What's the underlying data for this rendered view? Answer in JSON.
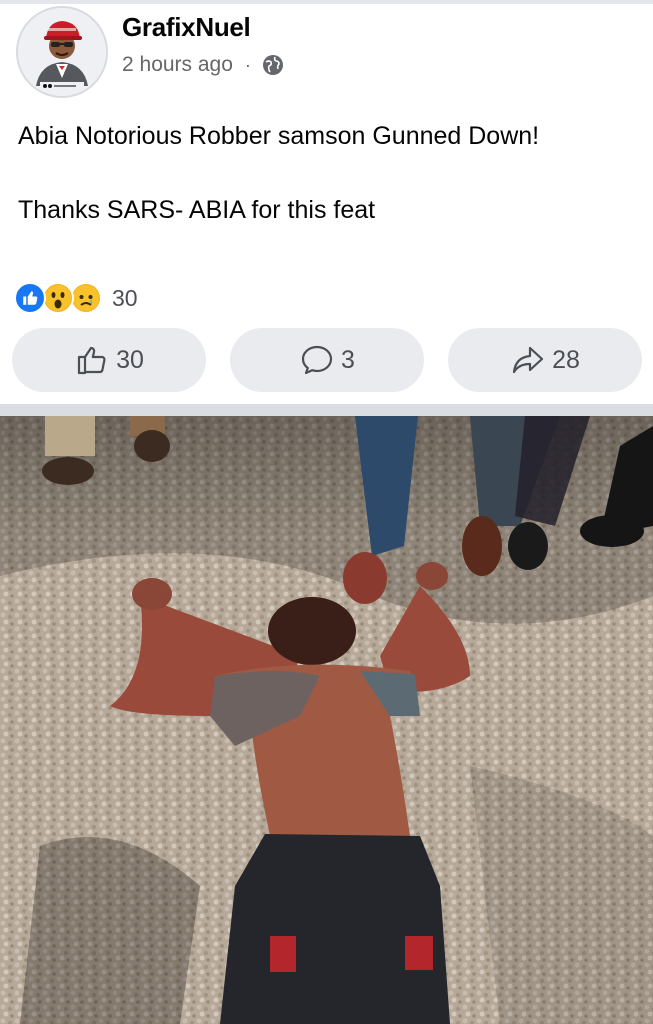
{
  "post": {
    "author": "GrafixNuel",
    "time": "2 hours ago",
    "separator": "·",
    "audience_icon": "globe-icon",
    "text_line1": "Abia Notorious Robber samson Gunned Down!",
    "text_line2": "Thanks SARS- ABIA for this feat",
    "reactions": {
      "types": [
        "like",
        "wow",
        "sad"
      ],
      "count": "30"
    },
    "actions": {
      "like_count": "30",
      "comment_count": "3",
      "share_count": "28"
    }
  },
  "colors": {
    "like_blue": "#1877f2",
    "emoji_yellow": "#f7b125",
    "button_bg": "#eaebee",
    "meta_gray": "#65676b"
  }
}
